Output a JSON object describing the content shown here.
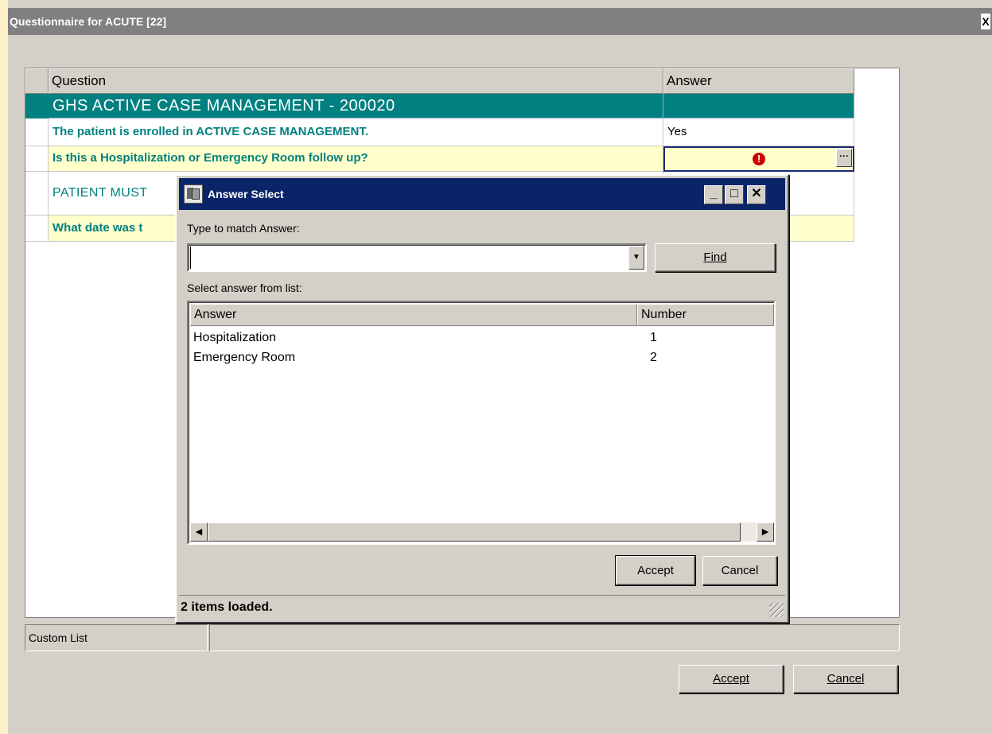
{
  "window": {
    "title": "Questionnaire for ACUTE [22]",
    "close_glyph": "X"
  },
  "grid": {
    "columns": {
      "question": "Question",
      "answer": "Answer"
    },
    "rows": [
      {
        "kind": "section",
        "question": "GHS ACTIVE CASE MANAGEMENT - 200020",
        "answer": ""
      },
      {
        "kind": "normal",
        "question": "The patient is enrolled in ACTIVE CASE MANAGEMENT.",
        "answer": "Yes"
      },
      {
        "kind": "active",
        "question": "Is this a Hospitalization or Emergency Room follow up?",
        "answer": "",
        "required_icon": "error-exclamation-icon"
      },
      {
        "kind": "normal",
        "question": "PATIENT MUST",
        "answer": ""
      },
      {
        "kind": "yellow",
        "question": "What date was t",
        "answer": ""
      }
    ]
  },
  "status": {
    "left": "Custom List",
    "right": ""
  },
  "buttons": {
    "accept": "Accept",
    "cancel": "Cancel"
  },
  "dialog": {
    "title": "Answer Select",
    "match_label": "Type to match Answer:",
    "match_value": "",
    "find_label": "Find",
    "list_label": "Select answer from list:",
    "list_columns": {
      "answer": "Answer",
      "number": "Number"
    },
    "list_items": [
      {
        "answer": "Hospitalization",
        "number": "1"
      },
      {
        "answer": "Emergency Room",
        "number": "2"
      }
    ],
    "accept_label": "Accept",
    "cancel_label": "Cancel",
    "status_text": "2 items loaded."
  },
  "colors": {
    "section_bg": "#008080",
    "question_text": "#00807f",
    "yellow_row": "#ffffcc",
    "dialog_titlebar": "#0a246a",
    "window_titlebar": "#808080"
  }
}
